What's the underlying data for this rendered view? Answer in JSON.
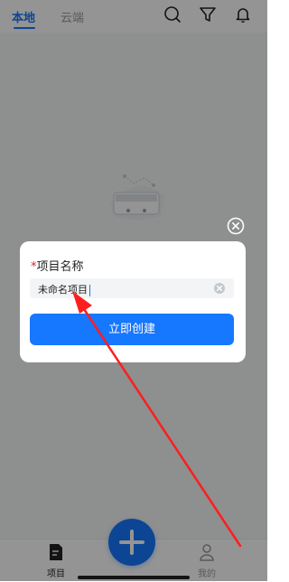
{
  "header": {
    "tabs": [
      {
        "label": "本地",
        "active": true
      },
      {
        "label": "云端",
        "active": false
      }
    ],
    "icons": [
      "search-icon",
      "filter-icon",
      "bell-icon"
    ]
  },
  "bottom_nav": {
    "items": [
      {
        "label": "项目",
        "icon": "document-icon",
        "active": true
      },
      {
        "label": "我的",
        "icon": "user-icon",
        "active": false
      }
    ],
    "fab_icon": "plus-icon"
  },
  "dialog": {
    "required_mark": "*",
    "title": "项目名称",
    "input_value": "未命名项目",
    "button_label": "立即创建"
  },
  "colors": {
    "accent": "#1677ff",
    "required": "#e02020",
    "annotation_arrow": "#ff1e1e"
  }
}
